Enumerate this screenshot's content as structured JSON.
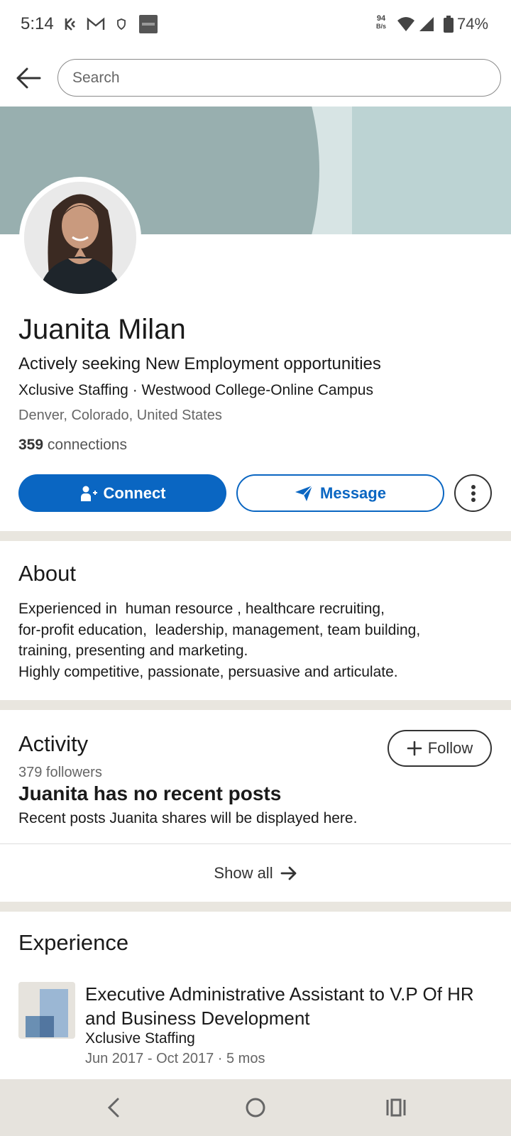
{
  "status_bar": {
    "time": "5:14",
    "net_speed_value": "94",
    "net_speed_unit": "B/s",
    "battery": "74%",
    "icons": [
      "kucoin-icon",
      "gmail-icon",
      "vpn-shield-icon",
      "bybit-icon",
      "wifi-icon",
      "signal-icon",
      "battery-icon"
    ]
  },
  "search": {
    "placeholder": "Search"
  },
  "profile": {
    "name": "Juanita Milan",
    "headline": "Actively seeking New Employment opportunities",
    "company_line": "Xclusive Staffing · Westwood College-Online Campus",
    "location": "Denver, Colorado, United States",
    "connections_count": "359",
    "connections_label": "connections",
    "connect_label": "Connect",
    "message_label": "Message"
  },
  "about": {
    "title": "About",
    "lines": [
      "Experienced in  human resource , healthcare recruiting,",
      "for-profit education,  leadership, management, team building,",
      "training, presenting and marketing.",
      "Highly competitive, passionate, persuasive and articulate."
    ]
  },
  "activity": {
    "title": "Activity",
    "followers": "379 followers",
    "follow_label": "Follow",
    "no_posts_title": "Juanita has no recent posts",
    "no_posts_sub": "Recent posts Juanita shares will be displayed here.",
    "show_all_label": "Show all"
  },
  "experience": {
    "title": "Experience",
    "items": [
      {
        "title": "Executive Administrative Assistant to V.P Of HR and Business Development",
        "company": "Xclusive Staffing",
        "dates": "Jun 2017 - Oct 2017 · 5 mos"
      }
    ]
  },
  "colors": {
    "brand_blue": "#0a66c2",
    "divider": "#e9e6df",
    "nav_bar": "#e6e3dd"
  }
}
